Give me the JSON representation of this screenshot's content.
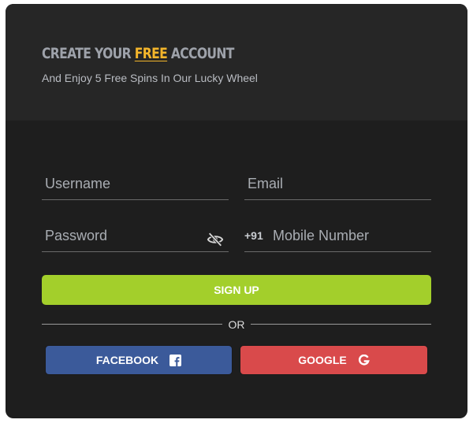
{
  "header": {
    "title_prefix": "CREATE YOUR ",
    "title_highlight": "FREE",
    "title_suffix": " ACCOUNT",
    "subtitle": "And Enjoy 5 Free Spins In Our Lucky Wheel"
  },
  "form": {
    "username_placeholder": "Username",
    "email_placeholder": "Email",
    "password_placeholder": "Password",
    "mobile_prefix": "+91",
    "mobile_placeholder": "Mobile Number",
    "password_toggle_icon": "eye-slash-icon"
  },
  "actions": {
    "signup_label": "SIGN UP",
    "divider_text": "OR",
    "facebook_label": "FACEBOOK",
    "facebook_icon": "facebook-icon",
    "google_label": "GOOGLE",
    "google_icon": "google-icon"
  },
  "colors": {
    "card_background": "#1e1e1e",
    "header_background": "#262626",
    "accent_free": "#f3b52b",
    "signup_green": "#a3cf2b",
    "facebook_blue": "#3b5a9a",
    "google_red": "#d94a4b"
  }
}
